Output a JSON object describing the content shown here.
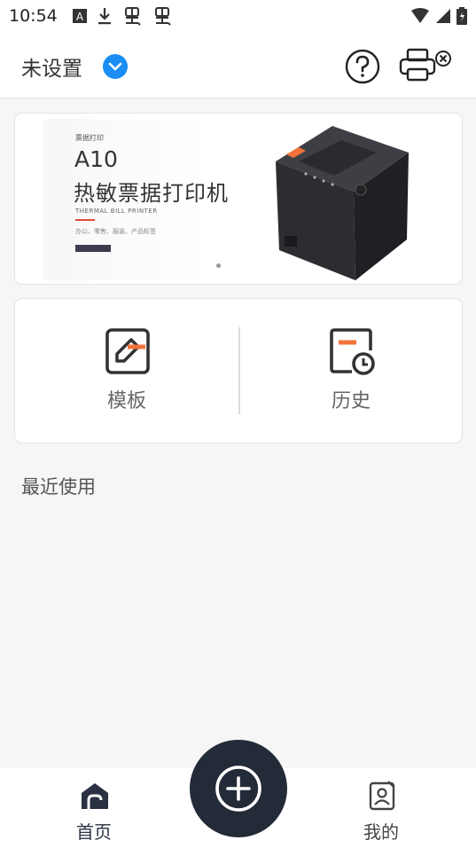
{
  "status_bar": {
    "time": "10:54",
    "left_icons": [
      "notification-a-icon",
      "download-icon",
      "bug-icon",
      "bug-icon"
    ],
    "right_icons": [
      "wifi-icon",
      "signal-icon",
      "battery-icon"
    ]
  },
  "header": {
    "title": "未设置",
    "icons": [
      "chevron-down-icon",
      "help-icon",
      "printer-disconnected-icon"
    ],
    "accent_color": "#1a8ef4"
  },
  "banner": {
    "small_label": "票据打印",
    "model": "A10",
    "headline": "热敏票据打印机",
    "english_subtitle": "THERMAL BILL PRINTER",
    "tags": "办公、零售、服装、产品标签"
  },
  "quick_actions": [
    {
      "label": "模板",
      "icon": "template-icon"
    },
    {
      "label": "历史",
      "icon": "history-icon"
    }
  ],
  "recent": {
    "title": "最近使用"
  },
  "bottom_nav": {
    "home_label": "首页",
    "mine_label": "我的",
    "fab_icon": "plus-circle-icon",
    "fab_color": "#232a38"
  }
}
